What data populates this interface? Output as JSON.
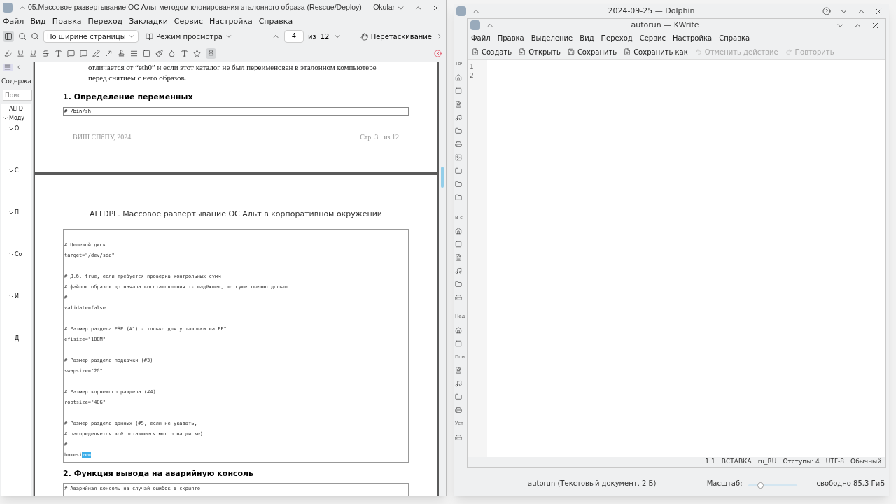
{
  "okular": {
    "title": "05.Массовое развертывание ОС Альт методом клонирования эталонного образа (Rescue/Deploy) — Okular",
    "menu": [
      "Файл",
      "Вид",
      "Правка",
      "Переход",
      "Закладки",
      "Сервис",
      "Настройка",
      "Справка"
    ],
    "zoom_mode": "По ширине страницы",
    "view_mode": "Режим просмотра",
    "page": "4",
    "of": "из",
    "total": "12",
    "drag_mode": "Перетаскивание",
    "sidebar": {
      "heading": "Содержа",
      "search_placeholder": "Поис...",
      "toc": [
        {
          "label": "ALTD",
          "expanded": false
        },
        {
          "label": "Моду",
          "expanded": true,
          "children": [
            {
              "label": "О",
              "expanded": true
            },
            {
              "label": "С",
              "expanded": true
            },
            {
              "label": "П",
              "expanded": true
            },
            {
              "label": "Со",
              "expanded": true
            },
            {
              "label": "И",
              "expanded": true
            },
            {
              "label": "Д",
              "expanded": false
            }
          ]
        }
      ]
    },
    "page1": {
      "paragraph_lines": [
        "отличается от “eth0” и если этот каталог не был переименован в эталонном компьютере",
        "перед снятием с него образов."
      ],
      "heading": "1. Определение переменных",
      "code": "#!/bin/sh",
      "footer_left": "ВИШ СПбПУ, 2024",
      "footer_page": "Стр. 3",
      "footer_total": "из 12"
    },
    "page2": {
      "header": "ALTDPL. Массовое развертывание ОС Альт в корпоративном окружении",
      "code_groups": [
        [
          "# Целевой диск",
          "target=\"/dev/sda\""
        ],
        [
          "# Д.б. true, если требуется проверка контрольных сумм",
          "# файлов образов до начала восстановления -- надёжнее, но существенно дольше!",
          "#",
          "validate=false"
        ],
        [
          "# Размер раздела ESP (#1) - только для установки на EFI",
          "efisize=\"100M\""
        ],
        [
          "# Размер раздела подкачки (#3)",
          "swapsize=\"2G\""
        ],
        [
          "# Размер корневого раздела (#4)",
          "rootsize=\"40G\""
        ],
        [
          "# Размер раздела данных (#5, если не указать,",
          "# распределяется всё оставшееся место на диске)",
          "#",
          "homesi"
        ]
      ],
      "selection": "ze=",
      "heading": "2. Функция вывода на аварийную консоль",
      "code2": "# Аварийная консоль на случай ошибок в скрипте"
    }
  },
  "dolphin": {
    "title": "2024-09-25 — Dolphin",
    "sidebar_labels": [
      "Точ",
      "В с",
      "Нед",
      "Пои",
      "Уст"
    ],
    "status": "autorun (Текстовый документ. 2 Б)",
    "zoom_label": "Масштаб:",
    "zoom": {
      "level": 0.25
    },
    "free_space": "свободно 85.3 ГиБ"
  },
  "kwrite": {
    "title": "autorun — KWrite",
    "menu": [
      "Файл",
      "Правка",
      "Выделение",
      "Вид",
      "Переход",
      "Сервис",
      "Настройка",
      "Справка"
    ],
    "toolbar": [
      {
        "kind": "new",
        "label": "Создать",
        "disabled": false
      },
      {
        "kind": "open",
        "label": "Открыть",
        "disabled": false
      },
      {
        "kind": "save",
        "label": "Сохранить",
        "disabled": false
      },
      {
        "kind": "saveas",
        "label": "Сохранить как",
        "disabled": false
      },
      {
        "kind": "undo",
        "label": "Отменить действие",
        "disabled": true
      },
      {
        "kind": "redo",
        "label": "Повторить",
        "disabled": true
      }
    ],
    "line_numbers": [
      "1",
      "2"
    ],
    "status": [
      "1:1",
      "ВСТАВКА",
      "ru_RU",
      "Отступы: 4",
      "UTF-8",
      "Обычный"
    ]
  }
}
